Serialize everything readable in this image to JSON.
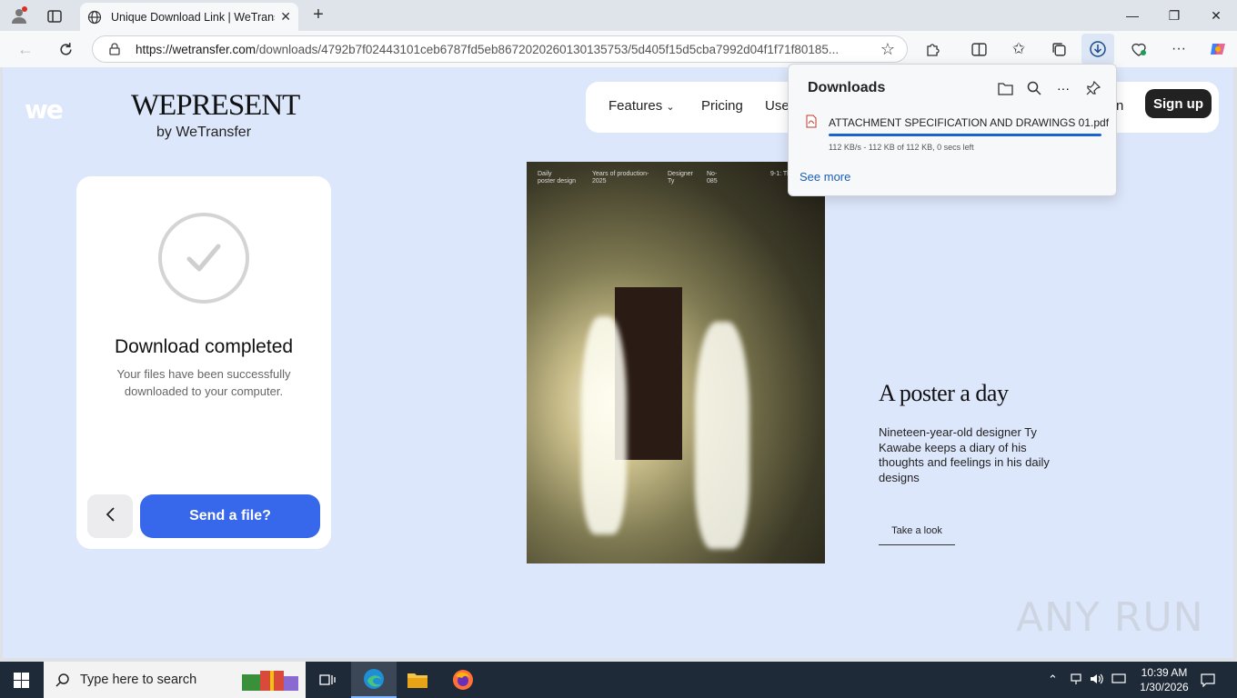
{
  "browser": {
    "tab_title": "Unique Download Link | WeTransfer",
    "url_host": "https://wetransfer.com",
    "url_path": "/downloads/4792b7f02443101ceb6787fd5eb8672020260130135753/5d405f15d5cba7992d04f1f71f80185..."
  },
  "site": {
    "we_logo": "we",
    "brand": "WEPRESENT",
    "brand_sub": "by WeTransfer",
    "nav": {
      "features": "Features",
      "pricing": "Pricing",
      "use_cases": "Use",
      "login": "n",
      "signup": "Sign up"
    }
  },
  "card": {
    "heading": "Download completed",
    "subtext": "Your files have been successfully downloaded to your computer.",
    "send_button": "Send a file?"
  },
  "poster": {
    "meta1a": "Daily",
    "meta1b": "poster design",
    "meta2a": "Years of production-",
    "meta2b": "2025",
    "meta3a": "Designer",
    "meta3b": "Ty",
    "meta4a": "No-",
    "meta4b": "085",
    "meta5": "9-1: The F"
  },
  "article": {
    "title": "A poster a day",
    "description": "Nineteen-year-old designer Ty Kawabe keeps a diary of his thoughts and feelings in his daily designs",
    "link": "Take a look"
  },
  "downloads_panel": {
    "title": "Downloads",
    "file_name": "ATTACHMENT SPECIFICATION AND DRAWINGS 01.pdf",
    "progress": 1.0,
    "status": "112 KB/s - 112 KB of 112 KB, 0 secs left",
    "see_more": "See more"
  },
  "watermark": "ANY RUN",
  "taskbar": {
    "search_placeholder": "Type here to search",
    "time": "10:39 AM",
    "date": "1/30/2026"
  },
  "colors": {
    "page_bg": "#dde7fb",
    "send_button": "#3767ea",
    "signup_button": "#222222",
    "progress": "#1a64d0"
  }
}
